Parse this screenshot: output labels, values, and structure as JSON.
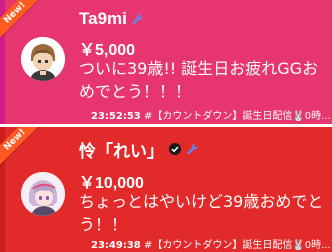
{
  "cards": [
    {
      "ribbon": "New!",
      "name": "Ta9mi",
      "amount": "￥5,000",
      "message": "ついに39歳!! 誕生日お疲れGGおめでとう！！！",
      "time": "23:52:53",
      "footer_text": "#【カウントダウン】誕生日配信🐰0時...",
      "badges": [
        "wrench-icon"
      ],
      "bg_color": "#e7366f",
      "accent_color": "#d11e88"
    },
    {
      "ribbon": "New!",
      "name": "怜「れい」",
      "amount": "￥10,000",
      "message": "ちょっとはやいけど39歳おめでとう！！",
      "time": "23:49:38",
      "footer_text": "#【カウントダウン】誕生日配信🐰0時...",
      "badges": [
        "verified-icon",
        "wrench-icon"
      ],
      "bg_color": "#e32a2b",
      "accent_color": "#c9201b"
    }
  ]
}
